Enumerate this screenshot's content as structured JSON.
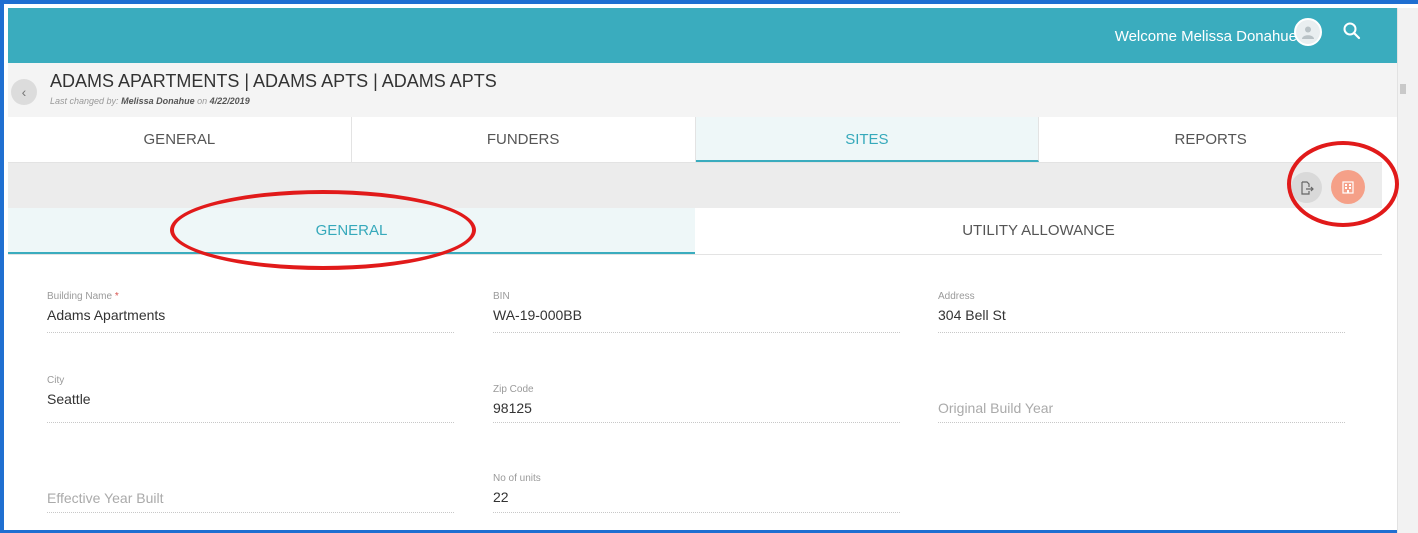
{
  "topbar": {
    "welcome_text": "Welcome Melissa Donahue",
    "avatar_icon": "user-avatar-icon",
    "search_icon": "search-icon"
  },
  "header": {
    "title": "ADAMS APARTMENTS | ADAMS APTS | ADAMS APTS",
    "last_changed_prefix": "Last changed by:",
    "last_changed_user": "Melissa Donahue",
    "last_changed_on": "on",
    "last_changed_date": "4/22/2019",
    "back_label": "‹"
  },
  "main_tabs": [
    "GENERAL",
    "FUNDERS",
    "SITES",
    "REPORTS"
  ],
  "active_main_tab": "SITES",
  "sub_tabs": [
    "GENERAL",
    "UTILITY ALLOWANCE"
  ],
  "active_sub_tab": "GENERAL",
  "actions": {
    "export_icon": "export-icon",
    "building_icon": "building-icon",
    "building_color": "#f5a088"
  },
  "form": {
    "building_name": {
      "label": "Building Name",
      "required_mark": "*",
      "value": "Adams Apartments"
    },
    "bin": {
      "label": "BIN",
      "value": "WA-19-000BB"
    },
    "address": {
      "label": "Address",
      "value": "304 Bell St"
    },
    "city": {
      "label": "City",
      "value": "Seattle"
    },
    "zip_code": {
      "label": "Zip Code",
      "value": "98125"
    },
    "original_build_year": {
      "placeholder": "Original Build Year"
    },
    "effective_year_built": {
      "placeholder": "Effective Year Built"
    },
    "no_of_units": {
      "label": "No of units",
      "value": "22"
    }
  },
  "colors": {
    "topbar": "#3aacbe",
    "accent": "#36a9bb",
    "annotation": "#e11a1a"
  }
}
